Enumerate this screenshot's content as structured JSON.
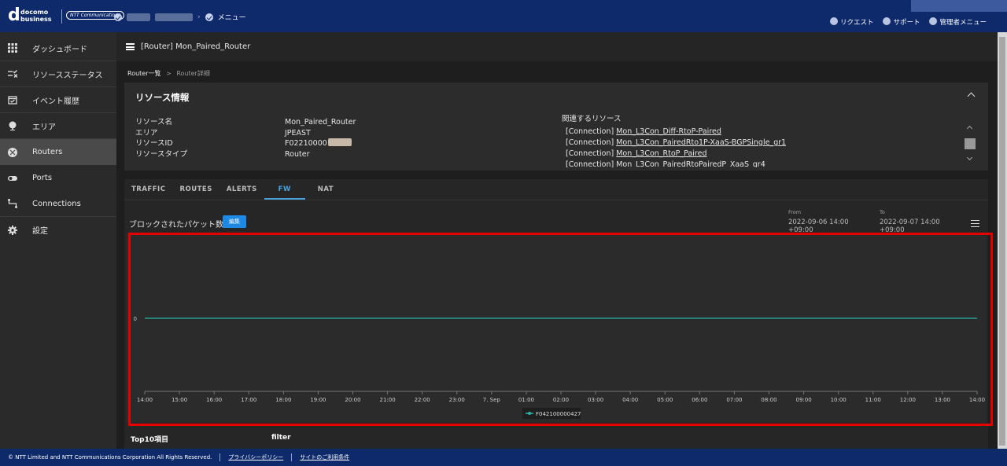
{
  "header": {
    "logo_mark": "d",
    "logo_text_line1": "docomo",
    "logo_text_line2": "business",
    "ntt_badge": "NTT Communications",
    "menu_label": "メニュー",
    "links": [
      "リクエスト",
      "サポート",
      "管理者メニュー"
    ]
  },
  "sidebar": {
    "items": [
      {
        "label": "ダッシュボード",
        "icon": "grid-icon"
      },
      {
        "label": "リソースステータス",
        "icon": "checklist-icon"
      },
      {
        "label": "イベント履歴",
        "icon": "calendar-icon"
      },
      {
        "label": "エリア",
        "icon": "globe-icon"
      },
      {
        "label": "Routers",
        "icon": "router-icon",
        "active": true
      },
      {
        "label": "Ports",
        "icon": "toggle-icon"
      },
      {
        "label": "Connections",
        "icon": "connection-icon"
      },
      {
        "label": "設定",
        "icon": "gear-icon"
      }
    ]
  },
  "page": {
    "title": "[Router] Mon_Paired_Router",
    "breadcrumb_parent": "Router一覧",
    "breadcrumb_sep": ">",
    "breadcrumb_current": "Router詳細"
  },
  "resource": {
    "heading": "リソース情報",
    "fields": [
      {
        "key": "リソース名",
        "value": "Mon_Paired_Router"
      },
      {
        "key": "エリア",
        "value": "JPEAST"
      },
      {
        "key": "リソースID",
        "value": "F02210000"
      },
      {
        "key": "リソースタイプ",
        "value": "Router"
      }
    ],
    "related_title": "関連するリソース",
    "related": [
      {
        "prefix": "[Connection]",
        "name": "Mon_L3Con_Diff-RtoP-Paired"
      },
      {
        "prefix": "[Connection]",
        "name": "Mon_L3Con_PairedRto1P-XaaS-BGPSingle_gr1"
      },
      {
        "prefix": "[Connection]",
        "name": "Mon_L3Con_RtoP_Paired"
      },
      {
        "prefix": "[Connection]",
        "name": "Mon_L3Con_PairedRtoPairedP_XaaS_gr4"
      }
    ]
  },
  "tabs": [
    "TRAFFIC",
    "ROUTES",
    "ALERTS",
    "FW",
    "NAT"
  ],
  "active_tab": "FW",
  "chart_section": {
    "title": "ブロックされたパケット数",
    "edit_label": "編集",
    "from_label": "From",
    "from_value": "2022-09-06 14:00 +09:00",
    "to_label": "To",
    "to_value": "2022-09-07 14:00 +09:00"
  },
  "chart_data": {
    "type": "line",
    "x": [
      "14:00",
      "15:00",
      "16:00",
      "17:00",
      "18:00",
      "19:00",
      "20:00",
      "21:00",
      "22:00",
      "23:00",
      "7. Sep",
      "01:00",
      "02:00",
      "03:00",
      "04:00",
      "05:00",
      "06:00",
      "07:00",
      "08:00",
      "09:00",
      "10:00",
      "11:00",
      "12:00",
      "13:00",
      "14:00"
    ],
    "series": [
      {
        "name": "F042100000427",
        "color": "#2bb3a3",
        "values": [
          0,
          0,
          0,
          0,
          0,
          0,
          0,
          0,
          0,
          0,
          0,
          0,
          0,
          0,
          0,
          0,
          0,
          0,
          0,
          0,
          0,
          0,
          0,
          0,
          0
        ]
      }
    ],
    "yticks": [
      "0"
    ],
    "legend": "bottom-center",
    "grid": false
  },
  "bottom": {
    "top10_label": "Top10項目",
    "filter_label": "filter"
  },
  "footer": {
    "copyright": "© NTT Limited and NTT Communications Corporation All Rights Reserved.",
    "privacy": "プライバシーポリシー",
    "terms": "サイトのご利用条件"
  }
}
